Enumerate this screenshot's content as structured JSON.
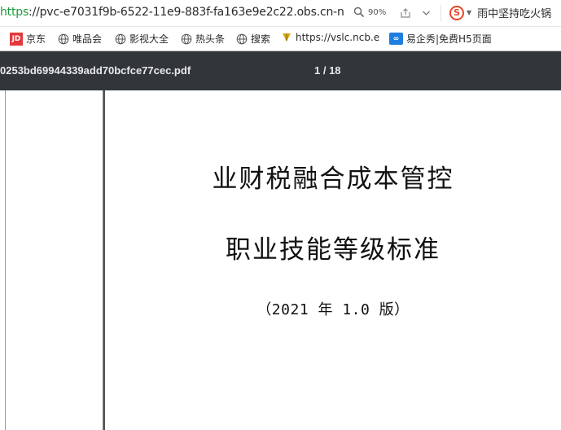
{
  "address_bar": {
    "url_scheme": "https",
    "url_rest": "://pvc-e7031f9b-6522-11e9-883f-fa163e9e2c22.obs.cn-n",
    "zoom": "90%",
    "hot_search": "雨中坚持吃火锅"
  },
  "bookmarks": [
    {
      "label": "京东",
      "icon": "jd-logo-icon",
      "badge": "JD"
    },
    {
      "label": "唯品会",
      "icon": "globe-icon"
    },
    {
      "label": "影视大全",
      "icon": "globe-icon"
    },
    {
      "label": "热头条",
      "icon": "globe-icon"
    },
    {
      "label": "搜索",
      "icon": "globe-icon"
    },
    {
      "label": "https://vslc.ncb.e",
      "icon": "leaf-icon"
    },
    {
      "label": "易企秀|免费H5页面",
      "icon": "yiqixiu-icon",
      "badge": "∞"
    }
  ],
  "pdf_toolbar": {
    "filename": "0253bd69944339add70bcfce77cec.pdf",
    "page_counter": "1 / 18"
  },
  "document": {
    "title": "业财税融合成本管控",
    "subtitle": "职业技能等级标准",
    "version": "（2021 年 1.0 版）"
  },
  "colors": {
    "url_scheme": "#1a9a3a",
    "toolbar_bg": "#323639",
    "viewer_bg": "#525659",
    "jd_red": "#e4393c",
    "sogou_red": "#e8472a",
    "yiqixiu_blue": "#1f7de0"
  }
}
